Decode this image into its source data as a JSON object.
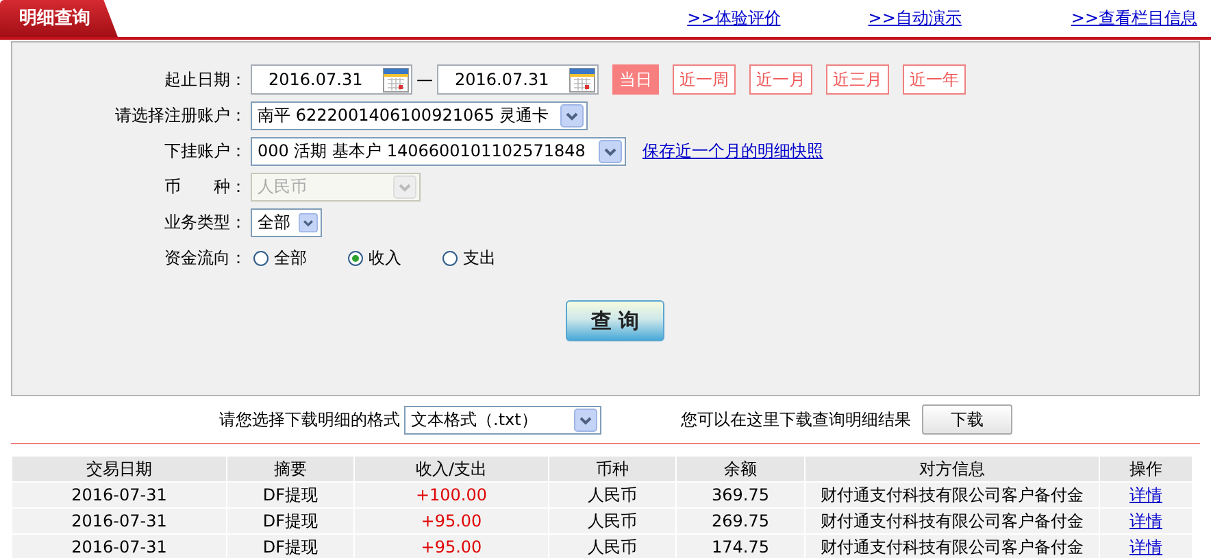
{
  "header": {
    "tab": "明细查询",
    "links": [
      ">>体验评价",
      ">>自动演示",
      ">>查看栏目信息"
    ]
  },
  "form": {
    "date_label": "起止日期：",
    "start_date": "2016.07.31",
    "dash": "—",
    "end_date": "2016.07.31",
    "quick_ranges": [
      {
        "label": "当日",
        "selected": true
      },
      {
        "label": "近一周",
        "selected": false
      },
      {
        "label": "近一月",
        "selected": false
      },
      {
        "label": "近三月",
        "selected": false
      },
      {
        "label": "近一年",
        "selected": false
      }
    ],
    "account_label": "请选择注册账户：",
    "account": "南平 6222001406100921065 灵通卡",
    "sub_account_label": "下挂账户：",
    "sub_account": "000 活期 基本户 1406600101102571848",
    "snapshot_link": "保存近一个月的明细快照",
    "currency_label": "币　　种：",
    "currency": {
      "value": "人民币",
      "disabled": true
    },
    "biz_type_label": "业务类型：",
    "biz_type": "全部",
    "flow_label": "资金流向：",
    "flow_options": [
      {
        "label": "全部",
        "selected": false
      },
      {
        "label": "收入",
        "selected": true
      },
      {
        "label": "支出",
        "selected": false
      }
    ],
    "query_button": "查 询"
  },
  "download": {
    "label": "请您选择下载明细的格式",
    "format": "文本格式（.txt）",
    "hint": "您可以在这里下载查询明细结果",
    "button": "下载"
  },
  "table": {
    "columns": [
      "交易日期",
      "摘要",
      "收入/支出",
      "币种",
      "余额",
      "对方信息",
      "操作"
    ],
    "rows": [
      {
        "date": "2016-07-31",
        "summary": "DF提现",
        "amount": "+100.00",
        "currency": "人民币",
        "balance": "369.75",
        "counterparty": "财付通支付科技有限公司客户备付金",
        "action": "详情"
      },
      {
        "date": "2016-07-31",
        "summary": "DF提现",
        "amount": "+95.00",
        "currency": "人民币",
        "balance": "269.75",
        "counterparty": "财付通支付科技有限公司客户备付金",
        "action": "详情"
      },
      {
        "date": "2016-07-31",
        "summary": "DF提现",
        "amount": "+95.00",
        "currency": "人民币",
        "balance": "174.75",
        "counterparty": "财付通支付科技有限公司客户备付金",
        "action": "详情"
      }
    ]
  }
}
